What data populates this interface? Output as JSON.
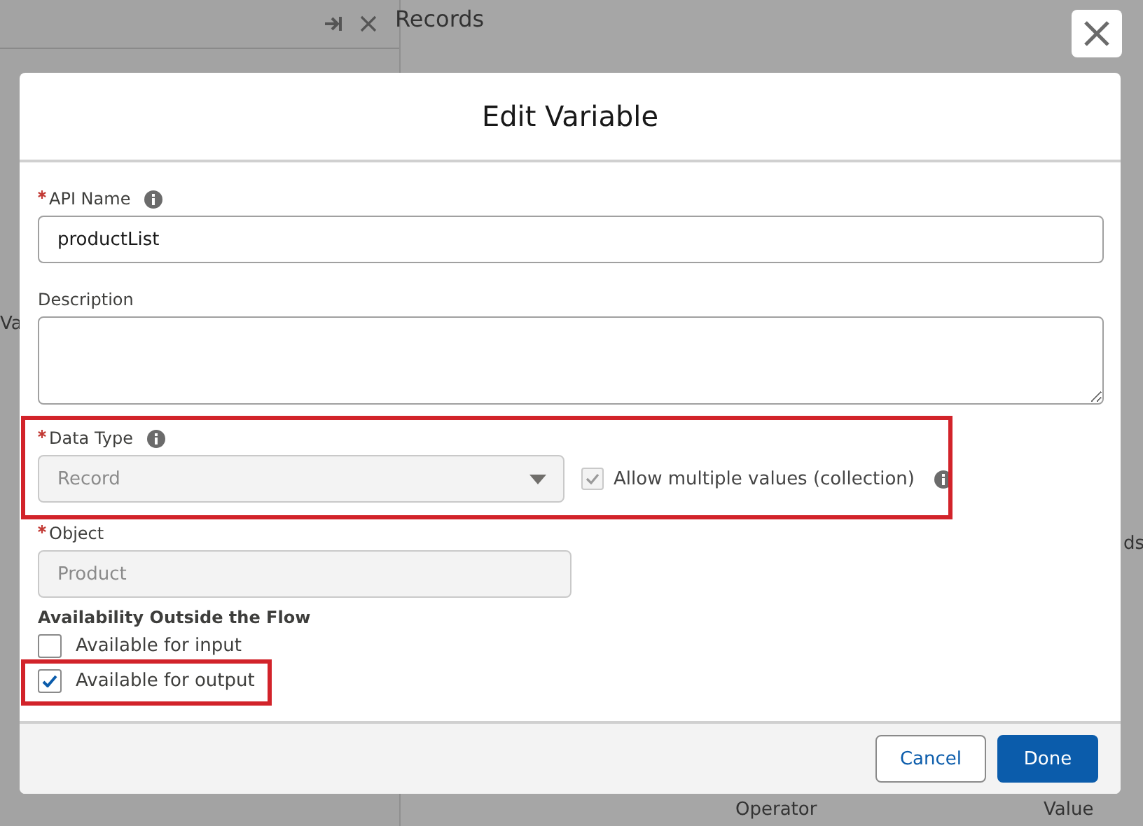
{
  "background": {
    "panel_texts": [
      "Va"
    ],
    "main_title": "Records",
    "main_texts": [
      "ds",
      "Operator",
      "Value"
    ]
  },
  "dialog": {
    "title": "Edit Variable",
    "api_name": {
      "label": "API Name",
      "required": true,
      "value": "productList"
    },
    "description": {
      "label": "Description"
    },
    "data_type": {
      "label": "Data Type",
      "required": true,
      "value": "Record",
      "disabled": true
    },
    "collection": {
      "label": "Allow multiple values (collection)",
      "checked": true,
      "disabled": true
    },
    "object": {
      "label": "Object",
      "required": true,
      "value": "Product",
      "disabled": true
    },
    "availability": {
      "heading": "Availability Outside the Flow",
      "options": [
        {
          "label": "Available for input",
          "checked": false
        },
        {
          "label": "Available for output",
          "checked": true
        }
      ]
    },
    "buttons": [
      {
        "label": "Cancel",
        "kind": "neutral"
      },
      {
        "label": "Done",
        "kind": "brand"
      }
    ]
  }
}
